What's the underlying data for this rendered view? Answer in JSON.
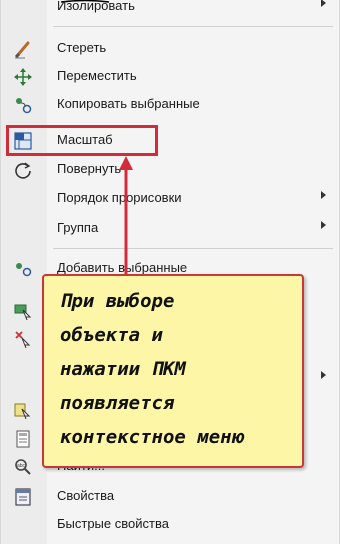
{
  "menu": {
    "items": [
      {
        "label": "Изолировать",
        "icon": "",
        "submenu": true
      },
      {
        "label": "Стереть",
        "icon": "eraser-icon",
        "submenu": false
      },
      {
        "label": "Переместить",
        "icon": "move-icon",
        "submenu": false
      },
      {
        "label": "Копировать выбранные",
        "icon": "copy-selected-icon",
        "submenu": false
      },
      {
        "label": "Масштаб",
        "icon": "scale-icon",
        "submenu": false
      },
      {
        "label": "Повернуть",
        "icon": "rotate-icon",
        "submenu": false
      },
      {
        "label": "Порядок прорисовки",
        "icon": "",
        "submenu": true
      },
      {
        "label": "Группа",
        "icon": "",
        "submenu": true
      },
      {
        "label": "Добавить выбранные",
        "icon": "add-selected-icon",
        "submenu": false
      },
      {
        "label": "Найти...",
        "icon": "find-icon",
        "submenu": false
      },
      {
        "label": "Свойства",
        "icon": "properties-icon",
        "submenu": false
      },
      {
        "label": "Быстрые свойства",
        "icon": "",
        "submenu": false
      }
    ],
    "hidden_icons": [
      "select-similar-icon",
      "deselect-icon",
      "quick-select-icon",
      "calculator-icon"
    ]
  },
  "highlight": {
    "item": "Масштаб",
    "color": "#d22c3a"
  },
  "callout": {
    "lines": [
      "При выборе",
      "объекта и",
      "нажатии ПКМ",
      "появляется",
      "контекстное меню"
    ],
    "background": "#fdf6a6",
    "border_color": "#c83838"
  },
  "colors": {
    "arrow": "#d22c3a",
    "menu_bg": "#f4f4f4"
  }
}
